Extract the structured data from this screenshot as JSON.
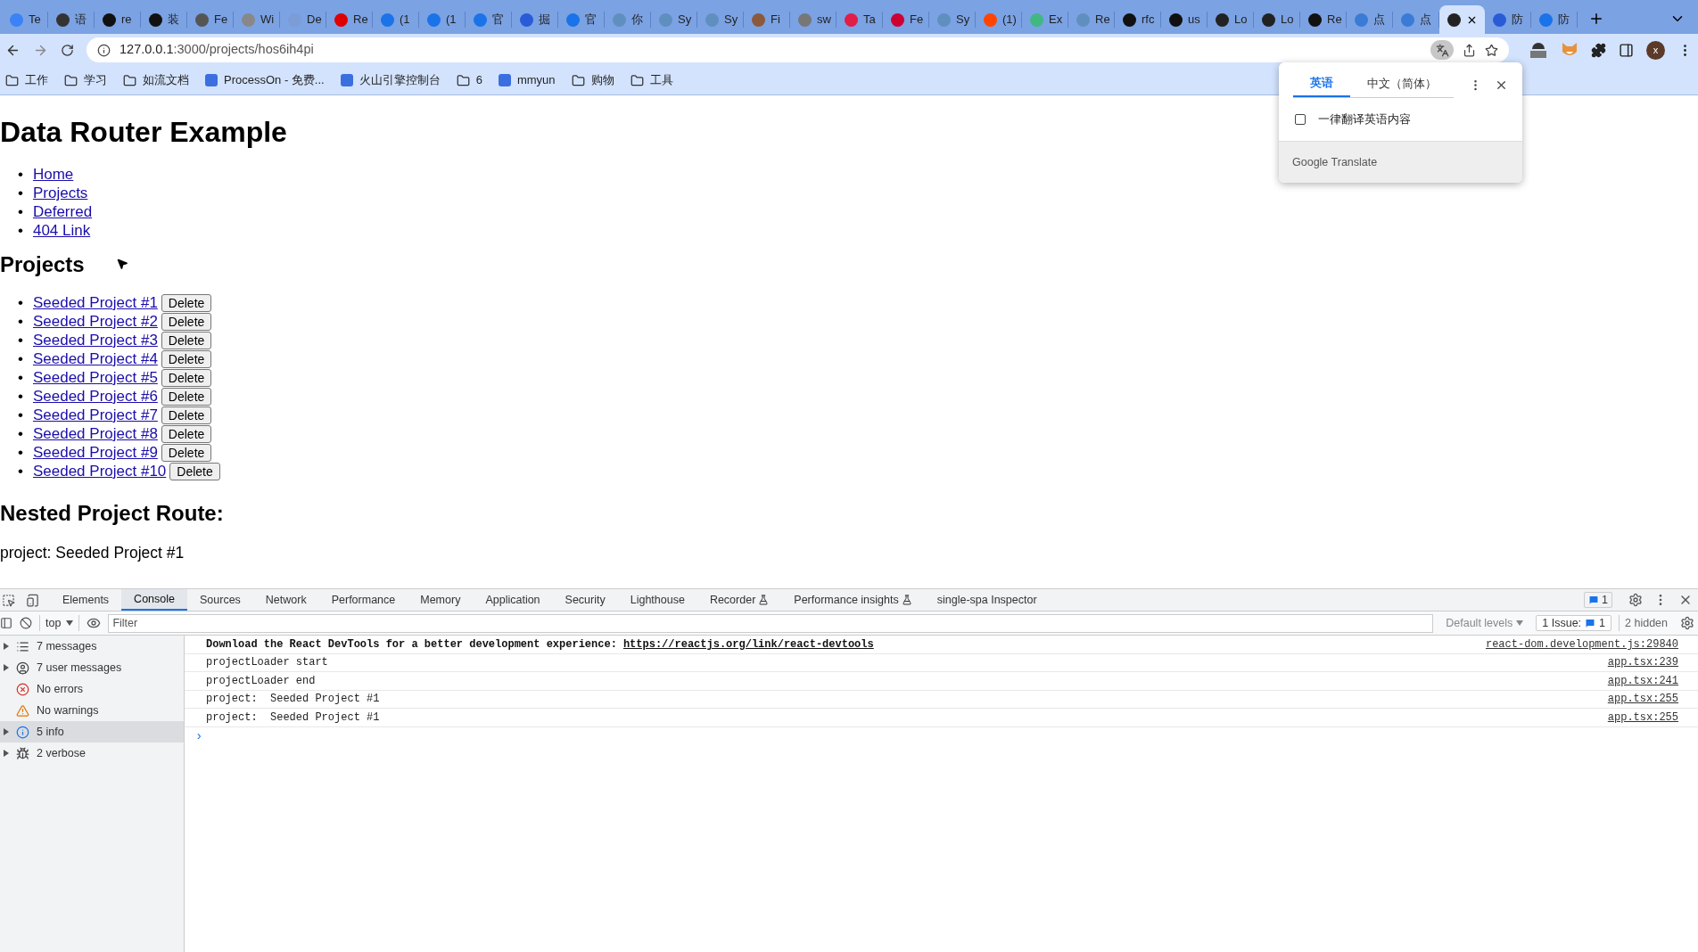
{
  "browser_tabs": [
    {
      "label": "Te",
      "selected": false,
      "color": "#3b82f6"
    },
    {
      "label": "语",
      "selected": false,
      "color": "#333333"
    },
    {
      "label": "re",
      "selected": false,
      "color": "#111111"
    },
    {
      "label": "装",
      "selected": false,
      "color": "#111111"
    },
    {
      "label": "Fe",
      "selected": false,
      "color": "#555555"
    },
    {
      "label": "Wi",
      "selected": false,
      "color": "#888888"
    },
    {
      "label": "De",
      "selected": false,
      "color": "#7c9cd6"
    },
    {
      "label": "Re",
      "selected": false,
      "color": "#e00000"
    },
    {
      "label": "(1",
      "selected": false,
      "color": "#1a73e8"
    },
    {
      "label": "(1",
      "selected": false,
      "color": "#1a73e8"
    },
    {
      "label": "官",
      "selected": false,
      "color": "#1a73e8"
    },
    {
      "label": "掘",
      "selected": false,
      "color": "#2a5bd7"
    },
    {
      "label": "官",
      "selected": false,
      "color": "#1a73e8"
    },
    {
      "label": "你",
      "selected": false,
      "color": "#5f8fbf"
    },
    {
      "label": "Sy",
      "selected": false,
      "color": "#5f8fbf"
    },
    {
      "label": "Sy",
      "selected": false,
      "color": "#5f8fbf"
    },
    {
      "label": "Fi",
      "selected": false,
      "color": "#8b5a3c"
    },
    {
      "label": "sw",
      "selected": false,
      "color": "#777777"
    },
    {
      "label": "Ta",
      "selected": false,
      "color": "#e11d48"
    },
    {
      "label": "Fe",
      "selected": false,
      "color": "#cc0033"
    },
    {
      "label": "Sy",
      "selected": false,
      "color": "#5f8fbf"
    },
    {
      "label": "(1)",
      "selected": false,
      "color": "#ff4500"
    },
    {
      "label": "Ex",
      "selected": false,
      "color": "#41b883"
    },
    {
      "label": "Re",
      "selected": false,
      "color": "#5f8fbf"
    },
    {
      "label": "rfc",
      "selected": false,
      "color": "#111111"
    },
    {
      "label": "us",
      "selected": false,
      "color": "#111111"
    },
    {
      "label": "Lo",
      "selected": false,
      "color": "#222222"
    },
    {
      "label": "Lo",
      "selected": false,
      "color": "#222222"
    },
    {
      "label": "Re",
      "selected": false,
      "color": "#111111"
    },
    {
      "label": "点",
      "selected": false,
      "color": "#3a7bd5"
    },
    {
      "label": "点",
      "selected": false,
      "color": "#3a7bd5"
    },
    {
      "selected": true,
      "color": "#222222"
    },
    {
      "label": "防",
      "selected": false,
      "color": "#2a5bd7"
    },
    {
      "label": "防",
      "selected": false,
      "color": "#1a73e8"
    }
  ],
  "address_bar": {
    "host": "127.0.0.1",
    "path": ":3000/projects/hos6ih4pi",
    "translate_active": true
  },
  "profile": {
    "initial": "x"
  },
  "bookmarks": [
    {
      "label": "工作",
      "kind": "folder"
    },
    {
      "label": "学习",
      "kind": "folder"
    },
    {
      "label": "如流文档",
      "kind": "folder"
    },
    {
      "label": "ProcessOn - 免费...",
      "kind": "site"
    },
    {
      "label": "火山引擎控制台",
      "kind": "site"
    },
    {
      "label": "6",
      "kind": "folder"
    },
    {
      "label": "mmyun",
      "kind": "site"
    },
    {
      "label": "购物",
      "kind": "folder"
    },
    {
      "label": "工具",
      "kind": "folder"
    }
  ],
  "translate_popup": {
    "tabs": [
      {
        "label": "英语",
        "selected": true
      },
      {
        "label": "中文（简体）",
        "selected": false
      }
    ],
    "option": {
      "label": "一律翻译英语内容",
      "checked": false
    },
    "footer": "Google Translate"
  },
  "page": {
    "title": "Data Router Example",
    "bullet": "•",
    "nav_links": [
      "Home",
      "Projects",
      "Deferred",
      "404 Link"
    ],
    "projects_heading": "Projects",
    "projects": [
      {
        "name": "Seeded Project #1",
        "action": "Delete"
      },
      {
        "name": "Seeded Project #2",
        "action": "Delete"
      },
      {
        "name": "Seeded Project #3",
        "action": "Delete"
      },
      {
        "name": "Seeded Project #4",
        "action": "Delete"
      },
      {
        "name": "Seeded Project #5",
        "action": "Delete"
      },
      {
        "name": "Seeded Project #6",
        "action": "Delete"
      },
      {
        "name": "Seeded Project #7",
        "action": "Delete"
      },
      {
        "name": "Seeded Project #8",
        "action": "Delete"
      },
      {
        "name": "Seeded Project #9",
        "action": "Delete"
      },
      {
        "name": "Seeded Project #10",
        "action": "Delete"
      }
    ],
    "nested_heading": "Nested Project Route:",
    "nested_text": "project: Seeded Project #1"
  },
  "devtools": {
    "tabs": [
      {
        "label": "Elements",
        "selected": false,
        "experimental": false
      },
      {
        "label": "Console",
        "selected": true,
        "experimental": false
      },
      {
        "label": "Sources",
        "selected": false,
        "experimental": false
      },
      {
        "label": "Network",
        "selected": false,
        "experimental": false
      },
      {
        "label": "Performance",
        "selected": false,
        "experimental": false
      },
      {
        "label": "Memory",
        "selected": false,
        "experimental": false
      },
      {
        "label": "Application",
        "selected": false,
        "experimental": false
      },
      {
        "label": "Security",
        "selected": false,
        "experimental": false
      },
      {
        "label": "Lighthouse",
        "selected": false,
        "experimental": false
      },
      {
        "label": "Recorder",
        "selected": false,
        "experimental": true
      },
      {
        "label": "Performance insights",
        "selected": false,
        "experimental": true
      },
      {
        "label": "single-spa Inspector",
        "selected": false,
        "experimental": false
      }
    ],
    "issues_badge": "1",
    "context": "top",
    "filter_placeholder": "Filter",
    "levels": "Default levels",
    "issues_label": "1 Issue:",
    "issues_count": "1",
    "hidden": "2 hidden",
    "sidebar": [
      {
        "label": "7 messages",
        "kind": "list",
        "expandable": true,
        "selected": false
      },
      {
        "label": "7 user messages",
        "kind": "user",
        "expandable": true,
        "selected": false
      },
      {
        "label": "No errors",
        "kind": "error",
        "expandable": false,
        "selected": false
      },
      {
        "label": "No warnings",
        "kind": "warning",
        "expandable": false,
        "selected": false
      },
      {
        "label": "5 info",
        "kind": "info",
        "expandable": true,
        "selected": true
      },
      {
        "label": "2 verbose",
        "kind": "verbose",
        "expandable": true,
        "selected": false
      }
    ],
    "messages": [
      {
        "text": "Download the React DevTools for a better development experience:",
        "link": "https://reactjs.org/link/react-devtools",
        "bold": true,
        "source": "react-dom.development.js:29840"
      },
      {
        "text": "projectLoader start",
        "bold": false,
        "source": "app.tsx:239"
      },
      {
        "text": "projectLoader end",
        "bold": false,
        "source": "app.tsx:241"
      },
      {
        "text": "project:  Seeded Project #1",
        "bold": false,
        "source": "app.tsx:255"
      },
      {
        "text": "project:  Seeded Project #1",
        "bold": false,
        "source": "app.tsx:255"
      }
    ],
    "prompt": "›"
  }
}
